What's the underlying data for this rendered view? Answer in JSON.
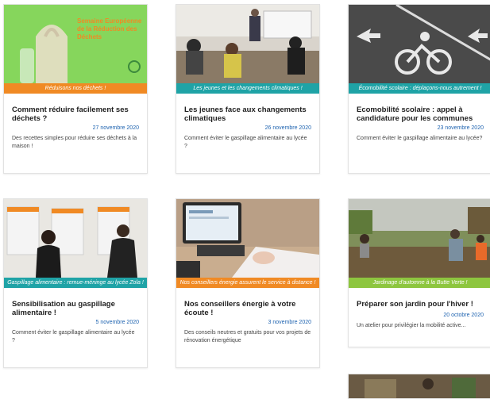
{
  "colors": {
    "orange": "#f08a24",
    "teal": "#1fa3a6",
    "green": "#8dc63f",
    "date_blue": "#1e63b0"
  },
  "cards": [
    {
      "image_text": "Semaine Européenne de la Réduction des Déchets",
      "banner": "Réduisons nos déchets !",
      "title": "Comment réduire facilement ses déchets ?",
      "date": "27 novembre 2020",
      "excerpt": "Des recettes simples pour réduire ses déchets à la maison !"
    },
    {
      "banner": "Les jeunes et les changements climatiques !",
      "title": "Les jeunes face aux changements climatiques",
      "date": "26 novembre 2020",
      "excerpt": "Comment éviter le gaspillage alimentaire au lycée ?"
    },
    {
      "banner": "Écomobilité scolaire : déplaçons-nous autrement !",
      "title": "Ecomobilité scolaire : appel à candidature pour les communes",
      "date": "23 novembre 2020",
      "excerpt": "Comment éviter le gaspillage alimentaire au lycée?"
    },
    {
      "banner": "Gaspillage alimentaire : remue-méninge au lycée Zola !",
      "title": "Sensibilisation au gaspillage alimentaire !",
      "date": "5 novembre 2020",
      "excerpt": "Comment éviter le gaspillage alimentaire au lycée ?"
    },
    {
      "banner": "Nos conseillers énergie assurent le service à distance !",
      "title": "Nos conseillers énergie à votre écoute !",
      "date": "3 novembre 2020",
      "excerpt": "Des conseils neutres et gratuits pour vos projets de rénovation énergétique"
    },
    {
      "banner": "Jardinage d'automne à la Butte Verte !",
      "title": "Préparer son jardin pour l'hiver !",
      "date": "20 octobre 2020",
      "excerpt": "Un atelier pour privilégier la mobilité active..."
    }
  ]
}
